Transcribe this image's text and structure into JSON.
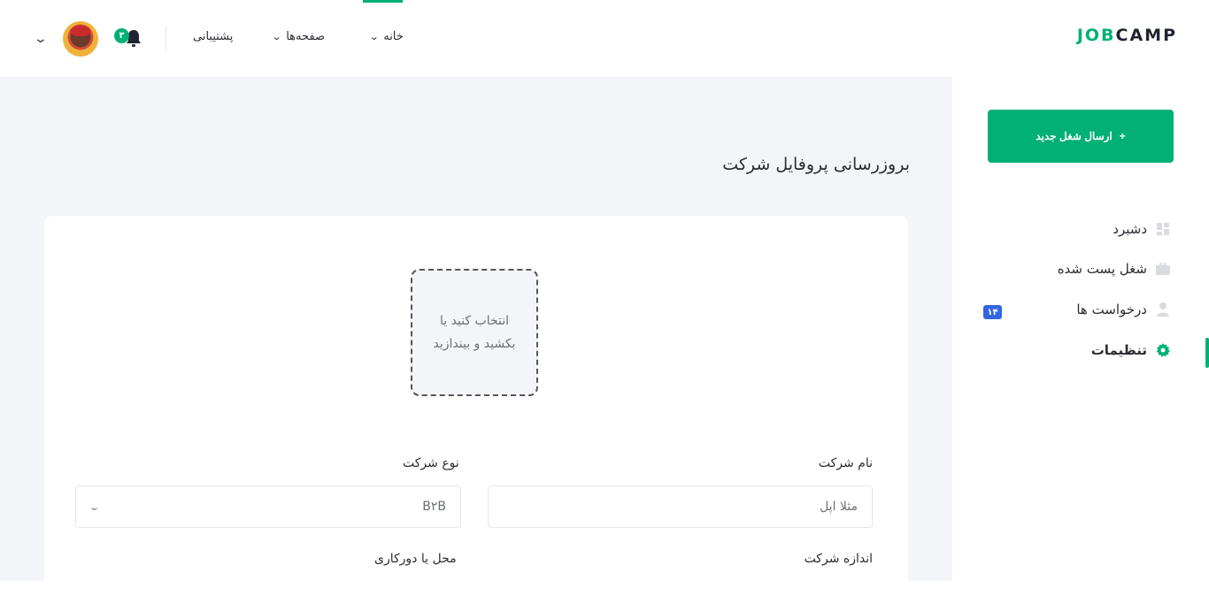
{
  "header": {
    "logo_part1": "JOB",
    "logo_part2": "CAMP",
    "nav": {
      "home": "خانه",
      "pages": "صفحه‌ها",
      "support": "پشتیبانی"
    },
    "notification_count": "۳",
    "icons": {
      "bell": "bell-icon",
      "chevron": "chevron-down-icon"
    }
  },
  "main": {
    "page_title": "بروزرسانی پروفایل شرکت",
    "upload": {
      "line1": "انتخاب کنید یا",
      "line2": "بکشید و بیندازید"
    },
    "fields": {
      "company_name_label": "نام شرکت",
      "company_name_placeholder": "مثلا اپل",
      "company_type_label": "نوع شرکت",
      "company_type_value": "B۲B",
      "company_size_label": "اندازه شرکت",
      "location_label": "محل یا دورکاری"
    }
  },
  "sidebar": {
    "post_button": "ارسال شغل جدید",
    "post_button_icon": "+",
    "items": [
      {
        "label": "دشبرد",
        "icon": "dashboard-icon"
      },
      {
        "label": "شغل پست شده",
        "icon": "briefcase-icon"
      },
      {
        "label": "درخواست ها",
        "icon": "user-icon",
        "badge": "۱۴"
      },
      {
        "label": "تنظیمات",
        "icon": "gear-icon",
        "active": true
      }
    ]
  },
  "colors": {
    "accent": "#00b074",
    "badge_blue": "#3366e0",
    "background": "#f4f5f8"
  }
}
